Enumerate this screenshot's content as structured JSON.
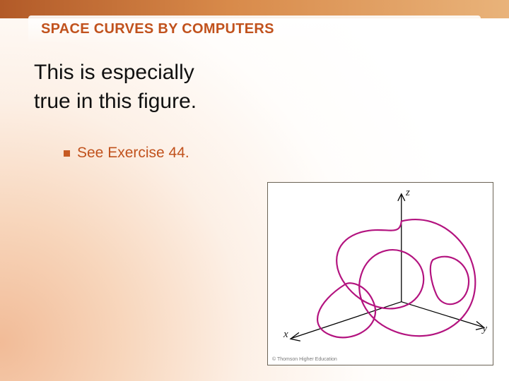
{
  "header": {
    "title": "SPACE CURVES BY COMPUTERS"
  },
  "body": {
    "line1": "This is especially",
    "line2": "true in this figure."
  },
  "bullet": {
    "text": "See Exercise 44."
  },
  "figure": {
    "axis_z": "z",
    "axis_x": "x",
    "axis_y": "y",
    "caption": "© Thomson Higher Education"
  }
}
